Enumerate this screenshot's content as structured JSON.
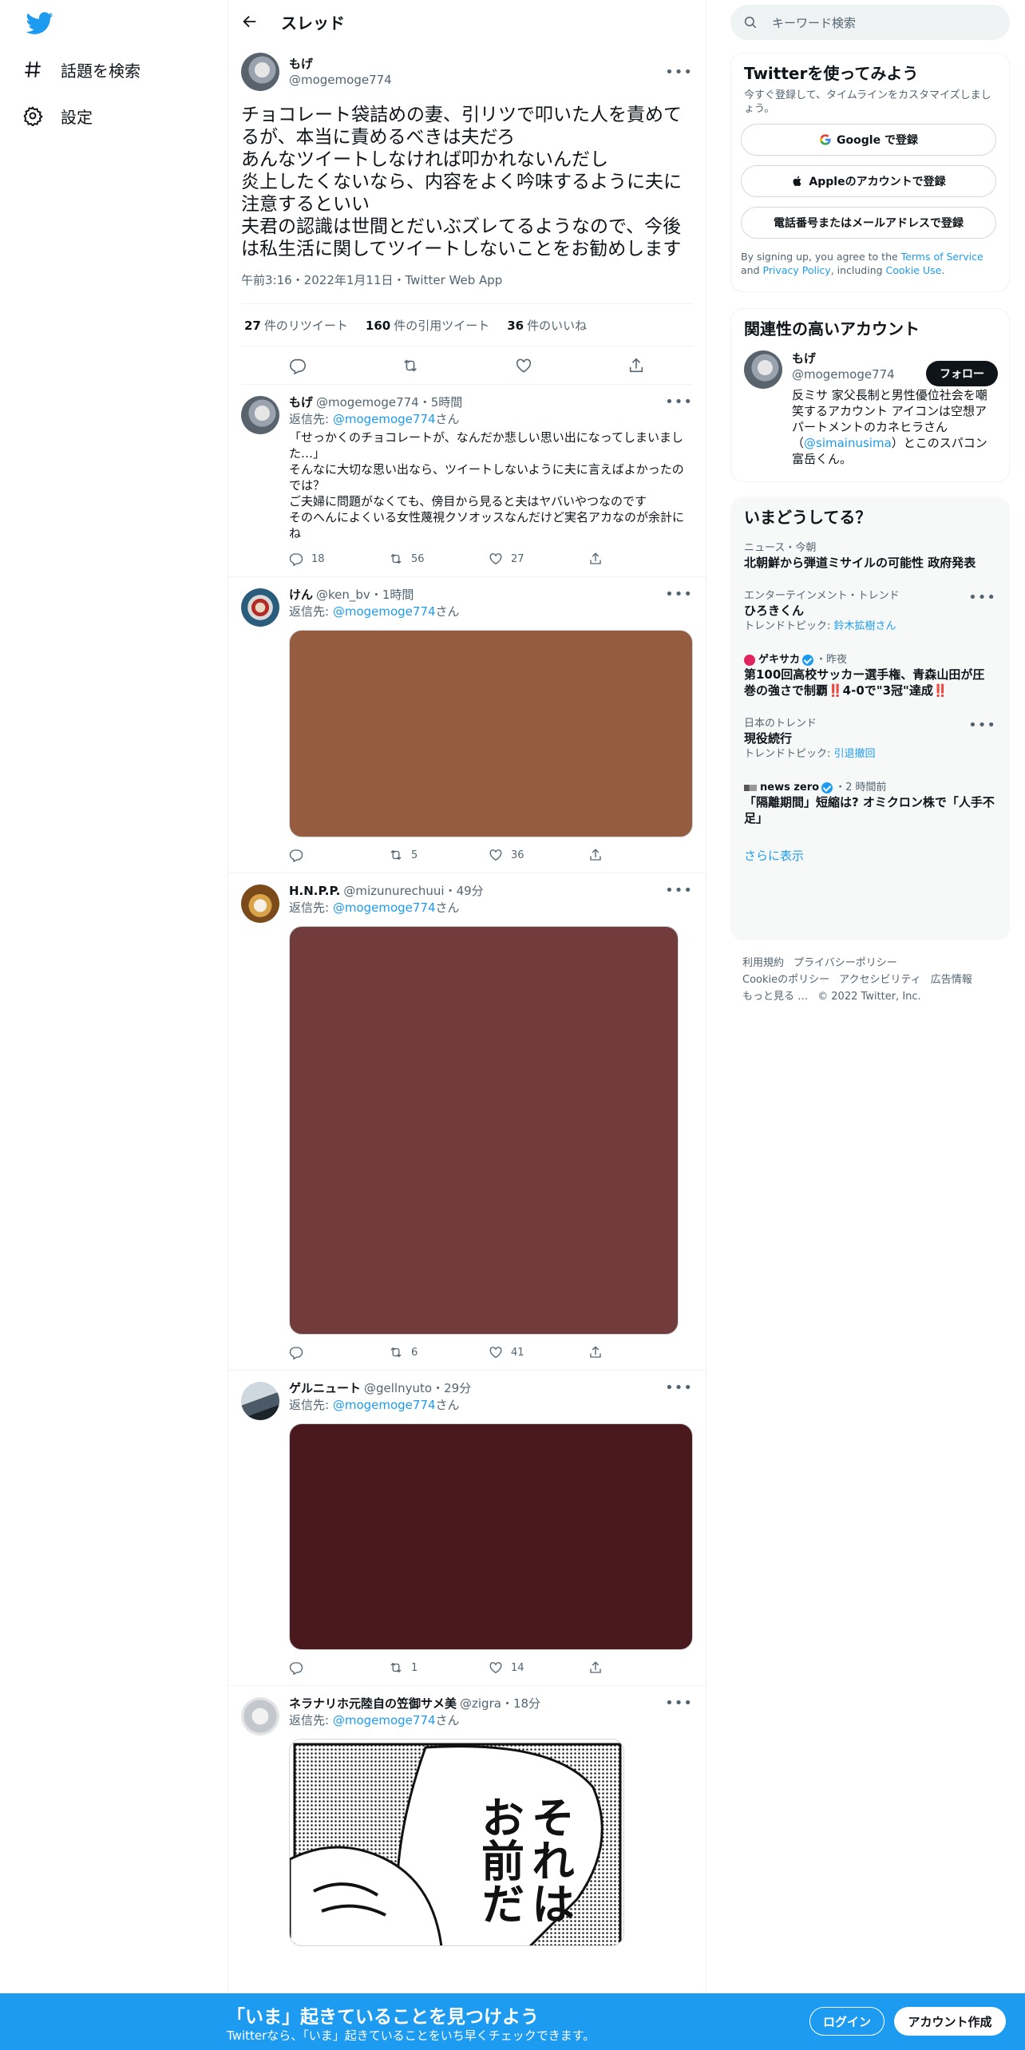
{
  "nav": {
    "explore_label": "話題を検索",
    "settings_label": "設定"
  },
  "header": {
    "title": "スレッド"
  },
  "focal": {
    "name": "もげ",
    "handle": "@mogemoge774",
    "text": "チョコレート袋詰めの妻、引リツで叩いた人を責めてるが、本当に責めるべきは夫だろ\nあんなツイートしなければ叩かれないんだし\n炎上したくないなら、内容をよく吟味するように夫に注意するといい\n夫君の認識は世間とだいぶズレてるようなので、今後は私生活に関してツイートしないことをお勧めします",
    "meta": "午前3:16・2022年1月11日・Twitter Web App",
    "retweets_num": "27",
    "retweets_label": "件のリツイート",
    "quotes_num": "160",
    "quotes_label": "件の引用ツイート",
    "likes_num": "36",
    "likes_label": "件のいいね"
  },
  "replies": [
    {
      "name": "もげ",
      "handle": "@mogemoge774",
      "time": "5時間",
      "reply_prefix": "返信先: ",
      "reply_to": "@mogemoge774",
      "reply_suffix": "さん",
      "text": "「せっかくのチョコレートが、なんだか悲しい思い出になってしまいました…」\nそんなに大切な思い出なら、ツイートしないように夫に言えばよかったのでは？\nご夫婦に問題がなくても、傍目から見ると夫はヤバいやつなのです\nそのへんによくいる女性蔑視クソオッスなんだけど実名アカなのが余計にね",
      "replies": "18",
      "retweets": "56",
      "likes": "27"
    },
    {
      "name": "けん",
      "handle": "@ken_bv",
      "time": "1時間",
      "reply_prefix": "返信先: ",
      "reply_to": "@mogemoge774",
      "reply_suffix": "さん",
      "media_color": "#955c40",
      "replies": "",
      "retweets": "5",
      "likes": "36"
    },
    {
      "name": "H.N.P.P.",
      "handle": "@mizunurechuui",
      "time": "49分",
      "reply_prefix": "返信先: ",
      "reply_to": "@mogemoge774",
      "reply_suffix": "さん",
      "media_color": "#733c3c",
      "replies": "",
      "retweets": "6",
      "likes": "41"
    },
    {
      "name": "ゲルニュート",
      "handle": "@gellnyuto",
      "time": "29分",
      "reply_prefix": "返信先: ",
      "reply_to": "@mogemoge774",
      "reply_suffix": "さん",
      "media_color": "#4a191e",
      "replies": "",
      "retweets": "1",
      "likes": "14"
    },
    {
      "name": "ネラナリホ元陸自の笠御サメ美",
      "handle": "@zigra",
      "time": "18分",
      "reply_prefix": "返信先: ",
      "reply_to": "@mogemoge774",
      "reply_suffix": "さん",
      "manga_line1": "それは",
      "manga_line2": "お前だ"
    }
  ],
  "sidebar": {
    "search_placeholder": "キーワード検索",
    "signup": {
      "title": "Twitterを使ってみよう",
      "subtitle": "今すぐ登録して、タイムラインをカスタマイズしましょう。",
      "google": "Google で登録",
      "apple": "Appleのアカウントで登録",
      "phone": "電話番号またはメールアドレスで登録",
      "terms_pre": "By signing up, you agree to the ",
      "terms_tos": "Terms of Service",
      "terms_and": " and ",
      "terms_privacy": "Privacy Policy",
      "terms_incl": ", including ",
      "terms_cookie": "Cookie Use",
      "terms_end": "."
    },
    "related": {
      "title": "関連性の高いアカウント",
      "name": "もげ",
      "handle": "@mogemoge774",
      "bio_pre": "反ミサ 家父長制と男性優位社会を嘲笑するアカウント アイコンは空想アパートメントのカネヒラさん（",
      "bio_link": "@simainusima",
      "bio_post": "）とこのスパコン富岳くん。",
      "follow": "フォロー"
    },
    "trends": {
      "title": "いまどうしてる？",
      "items": [
        {
          "sub": "ニュース・今朝",
          "title": "北朝鮮から弾道ミサイルの可能性 政府発表"
        },
        {
          "sub": "エンターテインメント・トレンド",
          "title": "ひろきくん",
          "topic_prefix": "トレンドトピック: ",
          "topic": "鈴木拡樹さん"
        },
        {
          "source": "ゲキサカ",
          "time": "・昨夜",
          "title": "第100回高校サッカー選手権、青森山田が圧巻の強さで制覇‼️4-0で\"3冠\"達成‼️"
        },
        {
          "sub": "日本のトレンド",
          "title": "現役続行",
          "topic_prefix": "トレンドトピック: ",
          "topic": "引退撤回"
        },
        {
          "source": "news zero",
          "time": "・2 時間前",
          "title": "「隔離期間」短縮は? オミクロン株で「人手不足」"
        }
      ],
      "show_more": "さらに表示"
    },
    "footer": {
      "terms": "利用規約",
      "privacy": "プライバシーポリシー",
      "cookie": "Cookieのポリシー",
      "accessibility": "アクセシビリティ",
      "ads": "広告情報",
      "more": "もっと見る …",
      "copyright": "© 2022 Twitter, Inc."
    }
  },
  "bottom_bar": {
    "title": "「いま」起きていることを見つけよう",
    "subtitle": "Twitterなら、「いま」起きていることをいち早くチェックできます。",
    "login": "ログイン",
    "signup": "アカウント作成"
  },
  "colors": {
    "accent": "#1d9bf0",
    "text": "#0f1419",
    "muted": "#536471"
  }
}
